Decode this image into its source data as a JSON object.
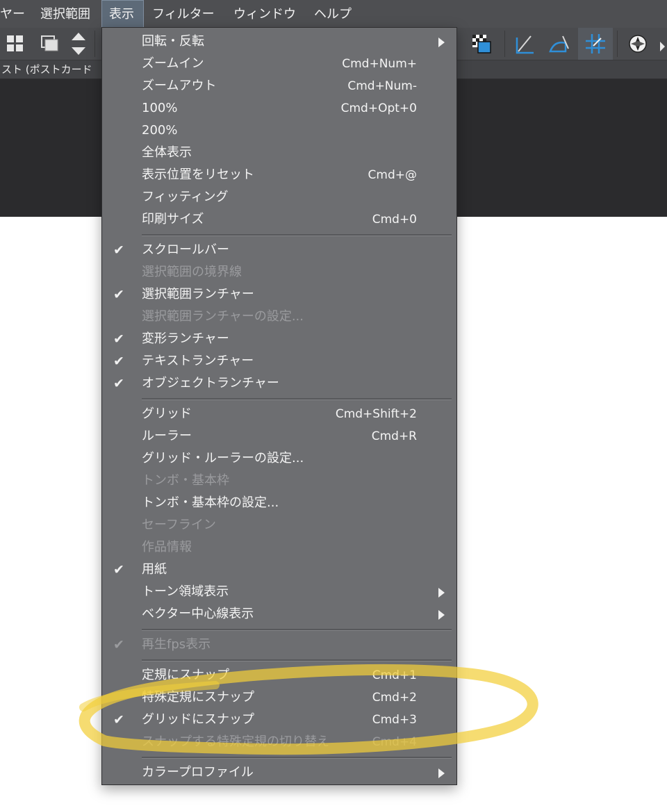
{
  "menubar": {
    "items": [
      "ヤー",
      "選択範囲",
      "表示",
      "フィルター",
      "ウィンドウ",
      "ヘルプ"
    ],
    "active_index": 2
  },
  "toolbar": {
    "left_icons": [
      "grid-icon",
      "layer-window-icon",
      "up-down-arrows-icon"
    ],
    "right_icons": [
      "checkerboard-layer-icon",
      "ruler-angle-icon",
      "ruler-curve-icon",
      "snap-grid-icon",
      "navigator-icon"
    ]
  },
  "tab": {
    "title": "スト (ポストカード"
  },
  "view_menu": {
    "items": [
      {
        "label": "回転・反転",
        "submenu": true
      },
      {
        "label": "ズームイン",
        "shortcut": "Cmd+Num+"
      },
      {
        "label": "ズームアウト",
        "shortcut": "Cmd+Num-"
      },
      {
        "label": "100%",
        "shortcut": "Cmd+Opt+0"
      },
      {
        "label": "200%"
      },
      {
        "label": "全体表示"
      },
      {
        "label": "表示位置をリセット",
        "shortcut": "Cmd+@"
      },
      {
        "label": "フィッティング"
      },
      {
        "label": "印刷サイズ",
        "shortcut": "Cmd+0"
      },
      {
        "separator": true
      },
      {
        "label": "スクロールバー",
        "checked": true
      },
      {
        "label": "選択範囲の境界線",
        "disabled": true
      },
      {
        "label": "選択範囲ランチャー",
        "checked": true
      },
      {
        "label": "選択範囲ランチャーの設定...",
        "disabled": true
      },
      {
        "label": "変形ランチャー",
        "checked": true
      },
      {
        "label": "テキストランチャー",
        "checked": true
      },
      {
        "label": "オブジェクトランチャー",
        "checked": true
      },
      {
        "separator": true
      },
      {
        "label": "グリッド",
        "shortcut": "Cmd+Shift+2"
      },
      {
        "label": "ルーラー",
        "shortcut": "Cmd+R"
      },
      {
        "label": "グリッド・ルーラーの設定..."
      },
      {
        "label": "トンボ・基本枠",
        "disabled": true
      },
      {
        "label": "トンボ・基本枠の設定..."
      },
      {
        "label": "セーフライン",
        "disabled": true
      },
      {
        "label": "作品情報",
        "disabled": true
      },
      {
        "label": "用紙",
        "checked": true
      },
      {
        "label": "トーン領域表示",
        "submenu": true
      },
      {
        "label": "ベクター中心線表示",
        "submenu": true
      },
      {
        "separator": true
      },
      {
        "label": "再生fps表示",
        "checked": true,
        "disabled": true
      },
      {
        "separator": true
      },
      {
        "label": "定規にスナップ",
        "shortcut": "Cmd+1"
      },
      {
        "label": "特殊定規にスナップ",
        "shortcut": "Cmd+2"
      },
      {
        "label": "グリッドにスナップ",
        "shortcut": "Cmd+3",
        "checked": true
      },
      {
        "label": "スナップする特殊定規の切り替え",
        "shortcut": "Cmd+4",
        "disabled": true
      },
      {
        "separator": true
      },
      {
        "label": "カラープロファイル",
        "submenu": true
      }
    ]
  },
  "annotation": {
    "color": "#f2cf3a"
  },
  "colors": {
    "menu_bg": "#6d6e71",
    "menubar_bg": "#4e4f52",
    "active_menu_bg": "#5d6a78",
    "disabled_text": "#9a9b9e",
    "toolbar_accent_blue": "#2f8fd8"
  }
}
